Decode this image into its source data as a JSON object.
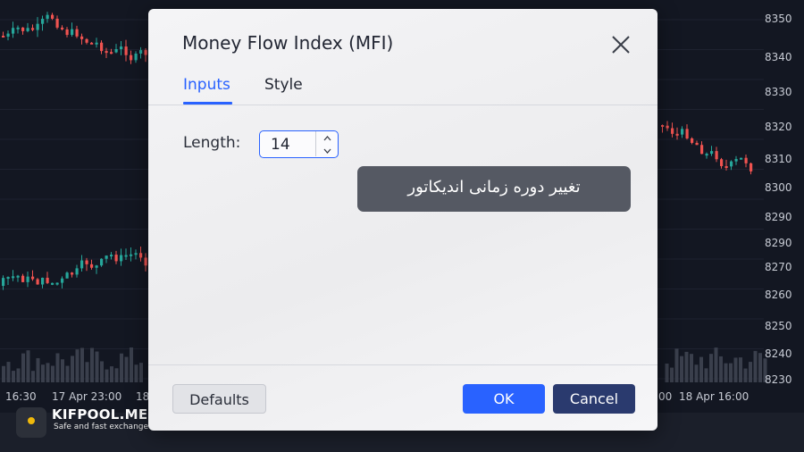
{
  "chart": {
    "price_axis": [
      "8350",
      "8340",
      "8330",
      "8320",
      "8310",
      "8300",
      "8290",
      "8290",
      "8270",
      "8260",
      "8250",
      "8240",
      "8230"
    ],
    "time_axis": [
      {
        "label": "16:30",
        "visible": true
      },
      {
        "label": "17 Apr 23:00",
        "visible": true
      },
      {
        "label": "18",
        "visible": true
      },
      {
        "label": "00",
        "visible": true
      },
      {
        "label": "18 Apr 16:00",
        "visible": true
      }
    ],
    "up_color": "#26a69a",
    "down_color": "#ef5350"
  },
  "watermark": {
    "title": "KIFPOOL.ME",
    "subtitle": "Safe and fast exchange"
  },
  "dialog": {
    "title": "Money Flow Index (MFI)",
    "tabs": [
      {
        "label": "Inputs",
        "active": true
      },
      {
        "label": "Style",
        "active": false
      }
    ],
    "length_label": "Length:",
    "length_value": "14",
    "tooltip": "تغییر دوره زمانی اندیکاتور",
    "buttons": {
      "defaults": "Defaults",
      "ok": "OK",
      "cancel": "Cancel"
    },
    "accent": "#2962ff"
  }
}
